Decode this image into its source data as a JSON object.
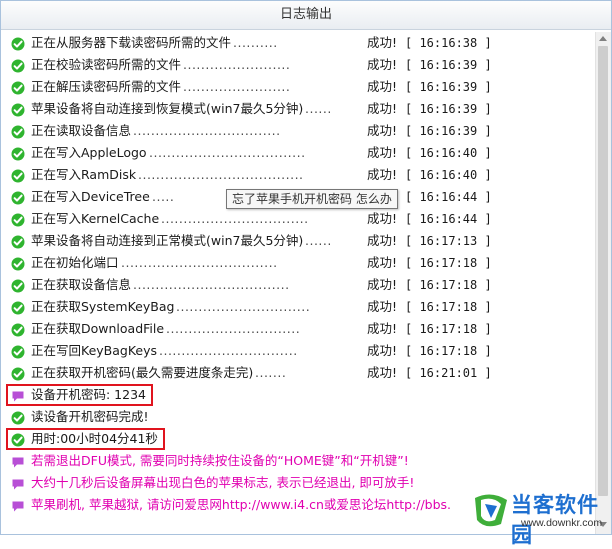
{
  "window": {
    "title": "日志输出"
  },
  "log": [
    {
      "icon": "check",
      "message": "正在从服务器下载读密码所需的文件",
      "dots": "..........",
      "result": "成功!",
      "time": "[ 16:16:38 ]"
    },
    {
      "icon": "check",
      "message": "正在校验读密码所需的文件",
      "dots": "........................",
      "result": "成功!",
      "time": "[ 16:16:39 ]"
    },
    {
      "icon": "check",
      "message": "正在解压读密码所需的文件",
      "dots": "........................",
      "result": "成功!",
      "time": "[ 16:16:39 ]"
    },
    {
      "icon": "check",
      "message": "苹果设备将自动连接到恢复模式(win7最久5分钟)",
      "dots": "......",
      "result": "成功!",
      "time": "[ 16:16:39 ]"
    },
    {
      "icon": "check",
      "message": "正在读取设备信息",
      "dots": ".................................",
      "result": "成功!",
      "time": "[ 16:16:39 ]"
    },
    {
      "icon": "check",
      "message": "正在写入AppleLogo",
      "dots": "...................................",
      "result": "成功!",
      "time": "[ 16:16:40 ]"
    },
    {
      "icon": "check",
      "message": "正在写入RamDisk",
      "dots": ".....................................",
      "result": "成功!",
      "time": "[ 16:16:40 ]"
    },
    {
      "icon": "check",
      "message": "正在写入DeviceTree",
      "dots": ".....",
      "result": "成功!",
      "time": "[ 16:16:44 ]"
    },
    {
      "icon": "check",
      "message": "正在写入KernelCache",
      "dots": ".................................",
      "result": "成功!",
      "time": "[ 16:16:44 ]"
    },
    {
      "icon": "check",
      "message": "苹果设备将自动连接到正常模式(win7最久5分钟)",
      "dots": "......",
      "result": "成功!",
      "time": "[ 16:17:13 ]"
    },
    {
      "icon": "check",
      "message": "正在初始化端口",
      "dots": "...................................",
      "result": "成功!",
      "time": "[ 16:17:18 ]"
    },
    {
      "icon": "check",
      "message": "正在获取设备信息",
      "dots": "...................................",
      "result": "成功!",
      "time": "[ 16:17:18 ]"
    },
    {
      "icon": "check",
      "message": "正在获取SystemKeyBag",
      "dots": "..............................",
      "result": "成功!",
      "time": "[ 16:17:18 ]"
    },
    {
      "icon": "check",
      "message": "正在获取DownloadFile",
      "dots": "..............................",
      "result": "成功!",
      "time": "[ 16:17:18 ]"
    },
    {
      "icon": "check",
      "message": "正在写回KeyBagKeys",
      "dots": "...............................",
      "result": "成功!",
      "time": "[ 16:17:18 ]"
    },
    {
      "icon": "check",
      "message": "正在获取开机密码(最久需要进度条走完)",
      "dots": ".......",
      "result": "成功!",
      "time": "[ 16:21:01 ]"
    },
    {
      "icon": "speech",
      "message": "设备开机密码: 1234",
      "highlight": true
    },
    {
      "icon": "check",
      "message": "读设备开机密码完成!"
    },
    {
      "icon": "check",
      "message": "用时:00小时04分41秒",
      "highlight": true
    },
    {
      "icon": "speech",
      "message": "若需退出DFU模式, 需要同时持续按住设备的“HOME键”和“开机键”!",
      "pink": true
    },
    {
      "icon": "speech",
      "message": "大约十几秒后设备屏幕出现白色的苹果标志, 表示已经退出, 即可放手!",
      "pink": true
    },
    {
      "icon": "speech",
      "message": "苹果刷机, 苹果越狱, 请访问爱思网http://www.i4.cn或爱思论坛http://bbs.",
      "pink": true
    }
  ],
  "tooltip": {
    "text": "忘了苹果手机开机密码 怎么办"
  },
  "watermark": {
    "name": "当客软件园",
    "url": "www.downkr.com"
  },
  "colors": {
    "check_green": "#2fb42f",
    "speech_purple": "#b84fd6",
    "pink_text": "#e000b0",
    "highlight_red": "#e0141e",
    "brand_blue": "#1e6fd0"
  }
}
